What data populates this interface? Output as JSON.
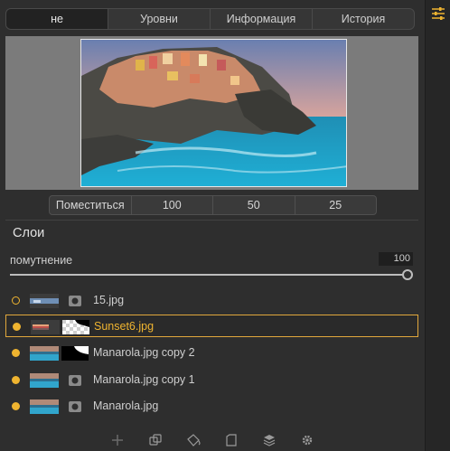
{
  "tabs": [
    {
      "label": "не",
      "active": true
    },
    {
      "label": "Уровни",
      "active": false
    },
    {
      "label": "Информация",
      "active": false
    },
    {
      "label": "История",
      "active": false
    }
  ],
  "zoom": {
    "fit_label": "Поместиться",
    "levels": [
      "100",
      "50",
      "25"
    ]
  },
  "layers_panel": {
    "title": "Слои",
    "opacity_label": "помутнение",
    "opacity_value": "100",
    "opacity_fraction": 1.0
  },
  "layers": [
    {
      "name": "15.jpg",
      "dot": "hollow",
      "selected": false
    },
    {
      "name": "Sunset6.jpg",
      "dot": "filled",
      "selected": true
    },
    {
      "name": "Manarola.jpg copy 2",
      "dot": "filled",
      "selected": false
    },
    {
      "name": "Manarola.jpg copy 1",
      "dot": "filled",
      "selected": false
    },
    {
      "name": "Manarola.jpg",
      "dot": "filled",
      "selected": false
    }
  ],
  "bottom_icons": [
    "add-layer-icon",
    "duplicate-layer-icon",
    "fill-icon",
    "new-page-icon",
    "layers-stack-icon",
    "settings-gear-icon"
  ],
  "colors": {
    "accent": "#efb430",
    "panel": "#2e2e2e",
    "preview_bg": "#7b7b7b"
  }
}
